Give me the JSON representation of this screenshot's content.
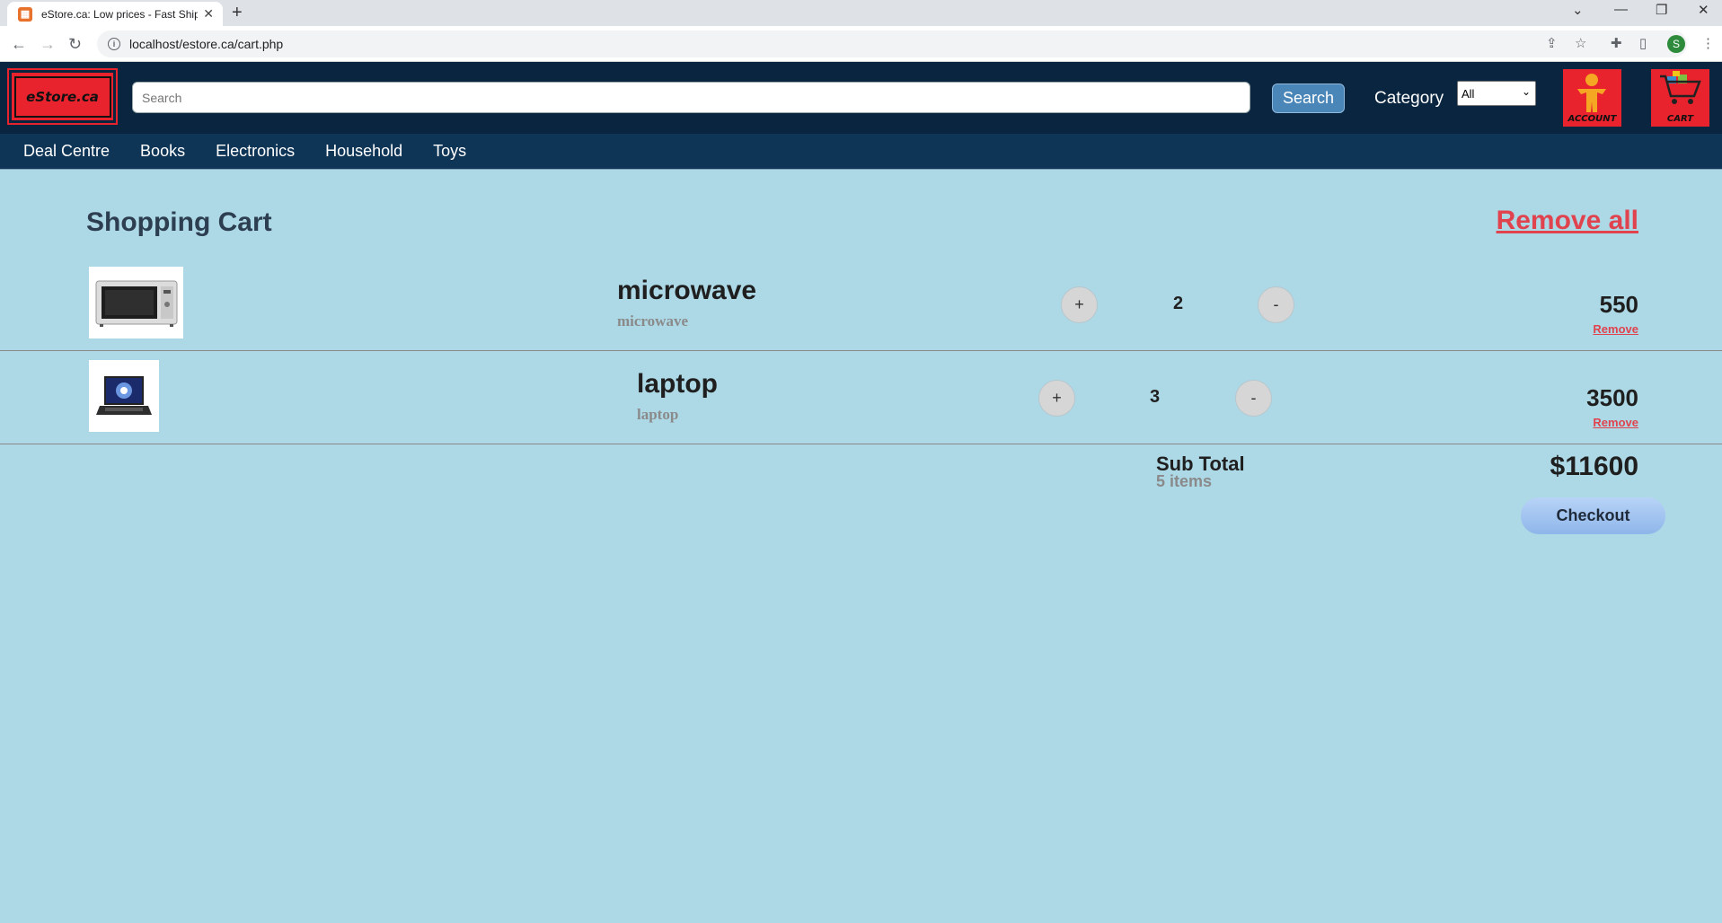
{
  "browser": {
    "tab_title": "eStore.ca: Low prices - Fast Shipp",
    "tab_close": "✕",
    "new_tab": "+",
    "url": "localhost/estore.ca/cart.php",
    "profile_initial": "S"
  },
  "header": {
    "logo_text": "eStore.ca",
    "search_placeholder": "Search",
    "search_button": "Search",
    "category_label": "Category",
    "category_selected": "All",
    "account_label": "ACCOUNT",
    "cart_label": "CART"
  },
  "nav": {
    "items": [
      "Deal Centre",
      "Books",
      "Electronics",
      "Household",
      "Toys"
    ]
  },
  "cart": {
    "heading": "Shopping Cart",
    "remove_all": "Remove all",
    "items": [
      {
        "name": "microwave",
        "sub": "microwave",
        "qty": "2",
        "price": "550",
        "remove": "Remove",
        "plus": "+",
        "minus": "-"
      },
      {
        "name": "laptop",
        "sub": "laptop",
        "qty": "3",
        "price": "3500",
        "remove": "Remove",
        "plus": "+",
        "minus": "-"
      }
    ],
    "subtotal_label": "Sub Total",
    "subtotal_items": "5 items",
    "subtotal_amount": "$11600",
    "checkout": "Checkout"
  }
}
